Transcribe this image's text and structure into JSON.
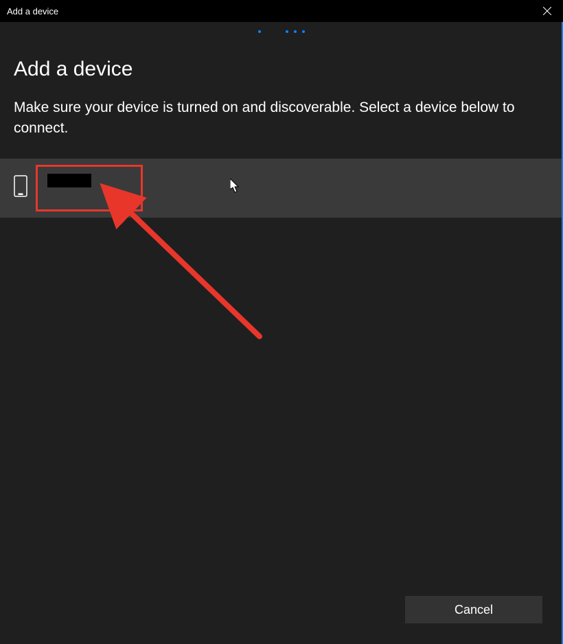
{
  "window": {
    "title": "Add a device"
  },
  "page": {
    "heading": "Add a device",
    "subtext": "Make sure your device is turned on and discoverable. Select a device below to connect."
  },
  "devices": [
    {
      "name": "",
      "icon": "phone-icon",
      "redacted": true
    }
  ],
  "footer": {
    "cancel_label": "Cancel"
  }
}
